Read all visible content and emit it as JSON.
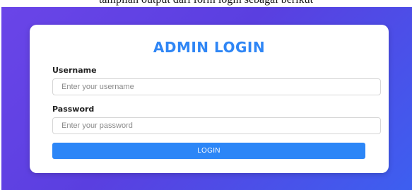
{
  "caption": "tampilan output dari form login sebagai berikut",
  "login_form": {
    "title": "ADMIN LOGIN",
    "username_label": "Username",
    "username_placeholder": "Enter your username",
    "password_label": "Password",
    "password_placeholder": "Enter your password",
    "login_label": "LOGIN"
  },
  "colors": {
    "background_start": "#6a45e8",
    "background_end": "#3d5ff0",
    "title": "#2f86f5",
    "button": "#2c86f7"
  }
}
